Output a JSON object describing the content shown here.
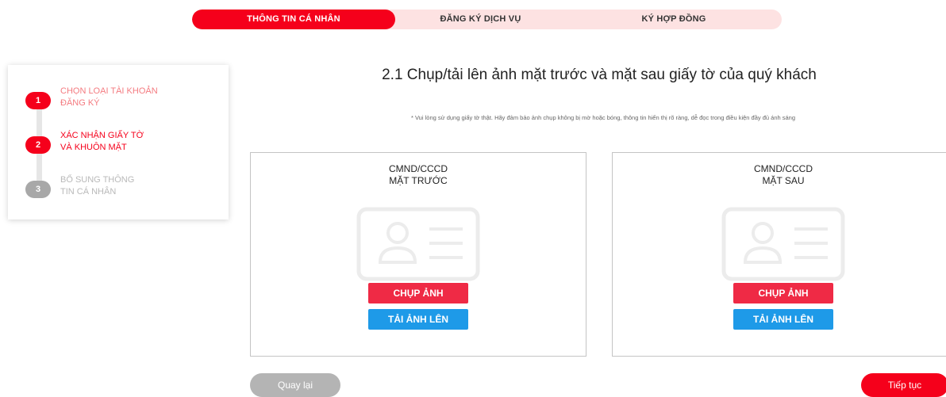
{
  "tabs": [
    {
      "label": "THÔNG TIN CÁ NHÂN",
      "active": true
    },
    {
      "label": "ĐĂNG KÝ DỊCH VỤ",
      "active": false
    },
    {
      "label": "KÝ HỢP ĐỒNG",
      "active": false
    }
  ],
  "steps": [
    {
      "number": "1",
      "line1": "CHỌN LOẠI TÀI KHOẢN",
      "line2": "ĐĂNG KÝ"
    },
    {
      "number": "2",
      "line1": "XÁC NHẬN GIẤY TỜ",
      "line2": "VÀ KHUÔN MẶT"
    },
    {
      "number": "3",
      "line1": "BỔ SUNG THÔNG",
      "line2": "TIN CÁ NHÂN"
    }
  ],
  "main": {
    "heading": "2.1 Chụp/tải lên ảnh mặt trước và mặt sau giấy tờ của quý khách",
    "note": "* Vui lòng sử dụng giấy tờ thật. Hãy đảm bảo ảnh chụp không bị mờ hoặc bóng, thông tin hiển thị rõ ràng, dễ đọc trong điều kiện đầy đủ ánh sáng"
  },
  "cards": [
    {
      "title_line1": "CMND/CCCD",
      "title_line2": "MẶT TRƯỚC",
      "capture_label": "CHỤP ẢNH",
      "upload_label": "TẢI ẢNH LÊN"
    },
    {
      "title_line1": "CMND/CCCD",
      "title_line2": "MẶT SAU",
      "capture_label": "CHỤP ẢNH",
      "upload_label": "TẢI ẢNH LÊN"
    }
  ],
  "footer": {
    "back_label": "Quay lại",
    "next_label": "Tiếp tục"
  },
  "colors": {
    "primary_red": "#f5001b",
    "capture_red": "#ef2a45",
    "upload_blue": "#1e9ae8",
    "tab_bg": "#fde2e2"
  }
}
